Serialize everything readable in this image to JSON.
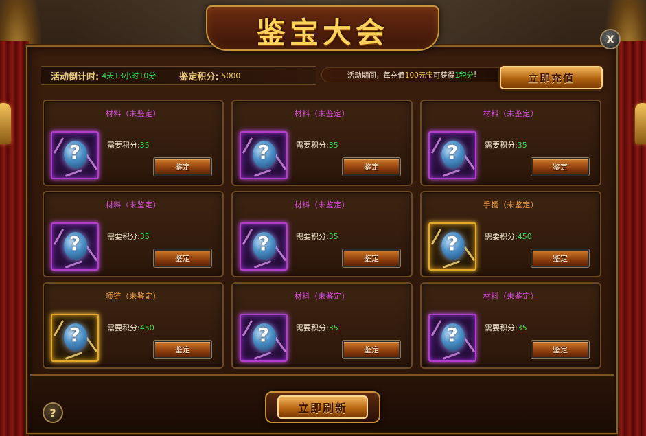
{
  "title": "鉴宝大会",
  "close_label": "X",
  "info": {
    "countdown_label": "活动倒计时:",
    "countdown_value": "4天13小时10分",
    "points_label": "鉴定积分:",
    "points_value": "5000"
  },
  "notice": {
    "prefix": "活动期间，每充值",
    "amount": "100元宝",
    "middle": "可获得",
    "reward": "1积分",
    "suffix": "!"
  },
  "recharge_label": "立即充值",
  "cards": [
    {
      "name": "材料",
      "status": "（未鉴定）",
      "rarity": "purple",
      "cost_label": "需要积分:",
      "cost": "35",
      "button": "鉴定"
    },
    {
      "name": "材料",
      "status": "（未鉴定）",
      "rarity": "purple",
      "cost_label": "需要积分:",
      "cost": "35",
      "button": "鉴定"
    },
    {
      "name": "材料",
      "status": "（未鉴定）",
      "rarity": "purple",
      "cost_label": "需要积分:",
      "cost": "35",
      "button": "鉴定"
    },
    {
      "name": "材料",
      "status": "（未鉴定）",
      "rarity": "purple",
      "cost_label": "需要积分:",
      "cost": "35",
      "button": "鉴定"
    },
    {
      "name": "材料",
      "status": "（未鉴定）",
      "rarity": "purple",
      "cost_label": "需要积分:",
      "cost": "35",
      "button": "鉴定"
    },
    {
      "name": "手镯",
      "status": "（未鉴定）",
      "rarity": "orange",
      "cost_label": "需要积分:",
      "cost": "450",
      "button": "鉴定"
    },
    {
      "name": "项链",
      "status": "（未鉴定）",
      "rarity": "orange",
      "cost_label": "需要积分:",
      "cost": "450",
      "button": "鉴定"
    },
    {
      "name": "材料",
      "status": "（未鉴定）",
      "rarity": "purple",
      "cost_label": "需要积分:",
      "cost": "35",
      "button": "鉴定"
    },
    {
      "name": "材料",
      "status": "（未鉴定）",
      "rarity": "purple",
      "cost_label": "需要积分:",
      "cost": "35",
      "button": "鉴定"
    }
  ],
  "refresh_label": "立即刷新",
  "help_label": "?",
  "colors": {
    "purple_rarity": "#dc4ee0",
    "orange_rarity": "#f2a044",
    "green_value": "#3fdc4f",
    "gold_accent": "#ffd25c"
  },
  "icons": {
    "unknown_item": "question-orb-icon",
    "close": "close-icon",
    "help": "help-icon"
  }
}
